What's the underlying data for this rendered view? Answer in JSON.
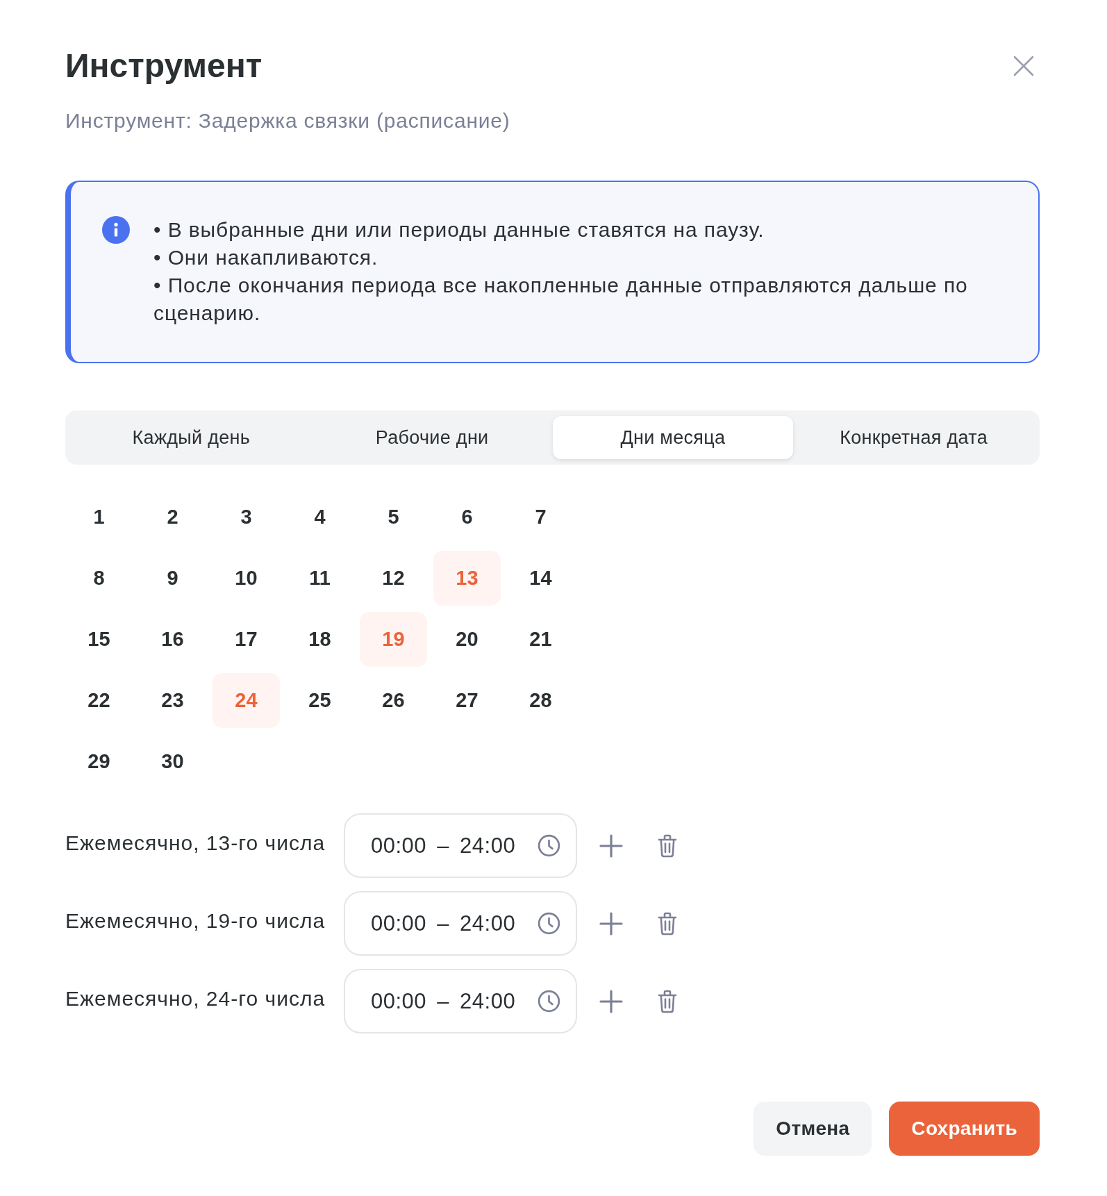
{
  "dialog": {
    "title": "Инструмент",
    "subtitle": "Инструмент: Задержка связки (расписание)"
  },
  "info": {
    "lines": [
      "• В выбранные дни или периоды данные ставятся на паузу.",
      "• Они накапливаются.",
      "• После окончания периода все накопленные данные отправляются дальше по сценарию."
    ]
  },
  "tabs": [
    {
      "label": "Каждый день",
      "selected": false
    },
    {
      "label": "Рабочие дни",
      "selected": false
    },
    {
      "label": "Дни месяца",
      "selected": true
    },
    {
      "label": "Конкретная дата",
      "selected": false
    }
  ],
  "calendar": {
    "days": [
      {
        "label": "1",
        "selected": false
      },
      {
        "label": "2",
        "selected": false
      },
      {
        "label": "3",
        "selected": false
      },
      {
        "label": "4",
        "selected": false
      },
      {
        "label": "5",
        "selected": false
      },
      {
        "label": "6",
        "selected": false
      },
      {
        "label": "7",
        "selected": false
      },
      {
        "label": "8",
        "selected": false
      },
      {
        "label": "9",
        "selected": false
      },
      {
        "label": "10",
        "selected": false
      },
      {
        "label": "11",
        "selected": false
      },
      {
        "label": "12",
        "selected": false
      },
      {
        "label": "13",
        "selected": true
      },
      {
        "label": "14",
        "selected": false
      },
      {
        "label": "15",
        "selected": false
      },
      {
        "label": "16",
        "selected": false
      },
      {
        "label": "17",
        "selected": false
      },
      {
        "label": "18",
        "selected": false
      },
      {
        "label": "19",
        "selected": true
      },
      {
        "label": "20",
        "selected": false
      },
      {
        "label": "21",
        "selected": false
      },
      {
        "label": "22",
        "selected": false
      },
      {
        "label": "23",
        "selected": false
      },
      {
        "label": "24",
        "selected": true
      },
      {
        "label": "25",
        "selected": false
      },
      {
        "label": "26",
        "selected": false
      },
      {
        "label": "27",
        "selected": false
      },
      {
        "label": "28",
        "selected": false
      },
      {
        "label": "29",
        "selected": false
      },
      {
        "label": "30",
        "selected": false
      }
    ]
  },
  "schedules": [
    {
      "label": "Ежемесячно, 13-го числа",
      "time_range": "00:00 – 24:00"
    },
    {
      "label": "Ежемесячно, 19-го числа",
      "time_range": "00:00 – 24:00"
    },
    {
      "label": "Ежемесячно, 24-го числа",
      "time_range": "00:00 – 24:00"
    }
  ],
  "buttons": [
    {
      "label": "Отмена",
      "kind": "secondary"
    },
    {
      "label": "Сохранить",
      "kind": "primary"
    }
  ]
}
